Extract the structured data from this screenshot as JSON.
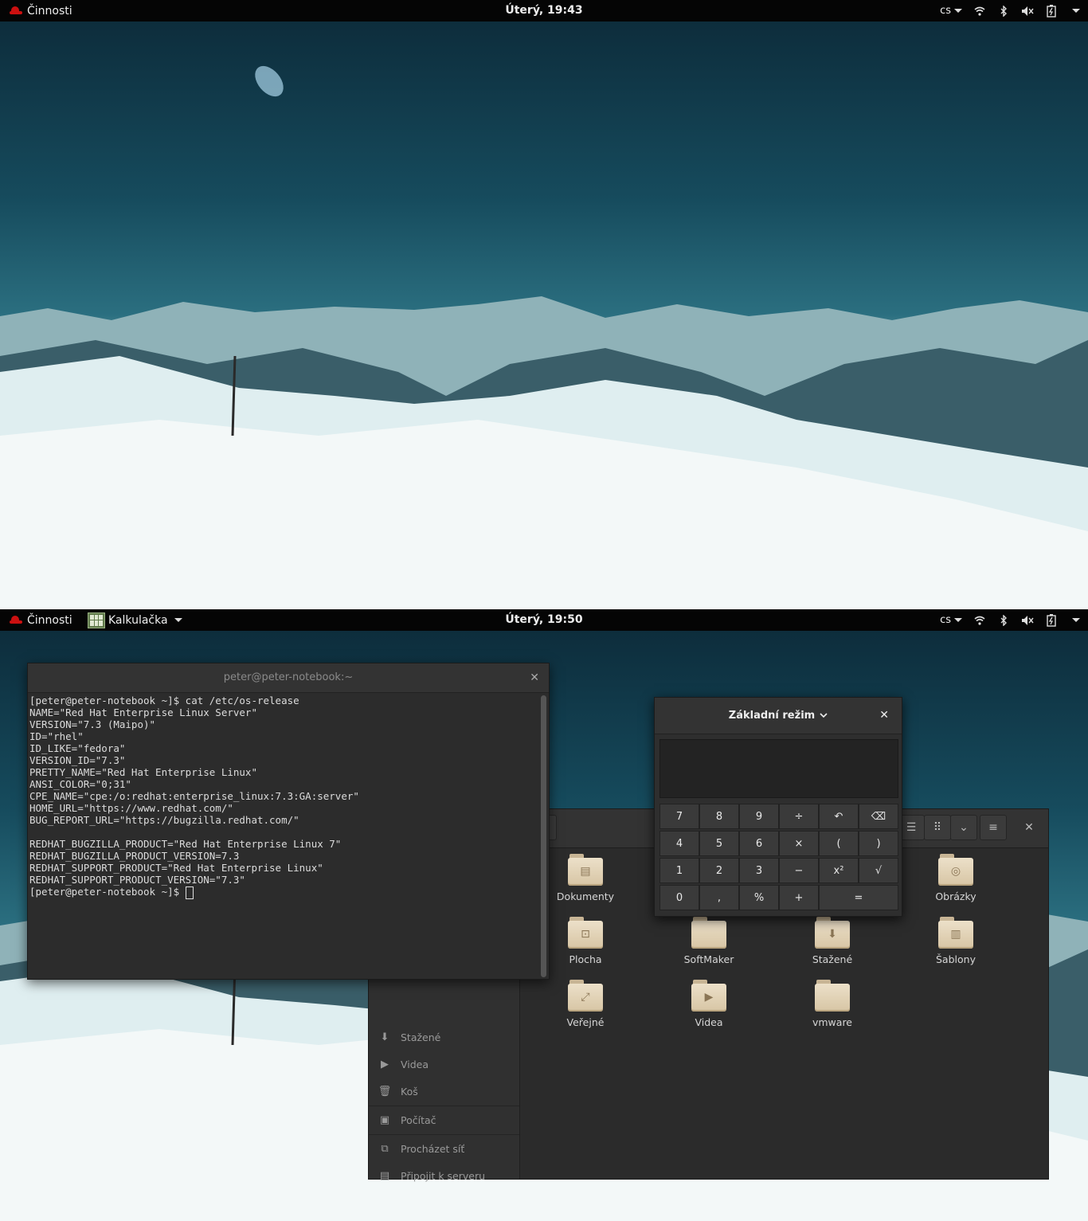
{
  "top_panel_1": {
    "activities": "Činnosti",
    "clock": "Úterý, 19:43",
    "lang": "cs"
  },
  "top_panel_2": {
    "activities": "Činnosti",
    "app_menu": "Kalkulačka",
    "clock": "Úterý, 19:50",
    "lang": "cs"
  },
  "terminal": {
    "title": "peter@peter-notebook:~",
    "lines": [
      "[peter@peter-notebook ~]$ cat /etc/os-release",
      "NAME=\"Red Hat Enterprise Linux Server\"",
      "VERSION=\"7.3 (Maipo)\"",
      "ID=\"rhel\"",
      "ID_LIKE=\"fedora\"",
      "VERSION_ID=\"7.3\"",
      "PRETTY_NAME=\"Red Hat Enterprise Linux\"",
      "ANSI_COLOR=\"0;31\"",
      "CPE_NAME=\"cpe:/o:redhat:enterprise_linux:7.3:GA:server\"",
      "HOME_URL=\"https://www.redhat.com/\"",
      "BUG_REPORT_URL=\"https://bugzilla.redhat.com/\"",
      "",
      "REDHAT_BUGZILLA_PRODUCT=\"Red Hat Enterprise Linux 7\"",
      "REDHAT_BUGZILLA_PRODUCT_VERSION=7.3",
      "REDHAT_SUPPORT_PRODUCT=\"Red Hat Enterprise Linux\"",
      "REDHAT_SUPPORT_PRODUCT_VERSION=\"7.3\""
    ],
    "prompt": "[peter@peter-notebook ~]$ "
  },
  "calculator": {
    "mode": "Základní režim",
    "keys": [
      [
        "7",
        "8",
        "9",
        "÷",
        "↶",
        "⌫"
      ],
      [
        "4",
        "5",
        "6",
        "×",
        "(",
        ")"
      ],
      [
        "1",
        "2",
        "3",
        "−",
        "x²",
        "√"
      ],
      [
        "0",
        ",",
        "%",
        "+",
        "="
      ]
    ]
  },
  "files": {
    "sidebar": [
      {
        "label": "Stažené",
        "icon": "download-icon"
      },
      {
        "label": "Videa",
        "icon": "video-icon"
      },
      {
        "label": "Koš",
        "icon": "trash-icon"
      },
      {
        "label": "Počítač",
        "icon": "computer-icon"
      },
      {
        "label": "Procházet síť",
        "icon": "network-icon"
      },
      {
        "label": "Připojit k serveru",
        "icon": "server-icon"
      }
    ],
    "folders": [
      {
        "label": "Dokumenty",
        "icon": "documents-folder-icon"
      },
      {
        "label": "Obrázky",
        "icon": "pictures-folder-icon"
      },
      {
        "label": "Plocha",
        "icon": "desktop-folder-icon"
      },
      {
        "label": "SoftMaker",
        "icon": "folder-icon"
      },
      {
        "label": "Stažené",
        "icon": "downloads-folder-icon"
      },
      {
        "label": "Šablony",
        "icon": "templates-folder-icon"
      },
      {
        "label": "Veřejné",
        "icon": "public-folder-icon"
      },
      {
        "label": "Videa",
        "icon": "videos-folder-icon"
      },
      {
        "label": "vmware",
        "icon": "folder-icon"
      }
    ]
  }
}
